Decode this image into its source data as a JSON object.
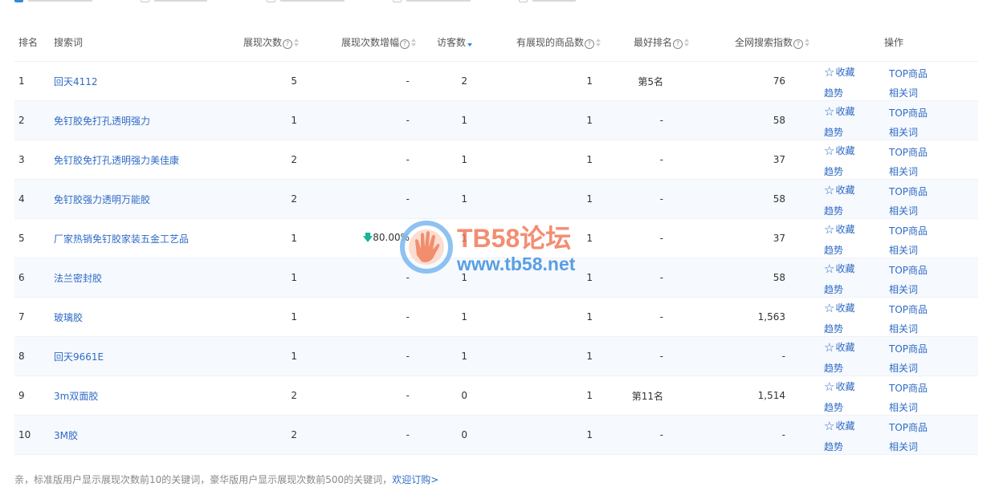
{
  "filters": [
    {
      "checked": true
    },
    {
      "checked": false
    },
    {
      "checked": false
    },
    {
      "checked": false
    },
    {
      "checked": false
    }
  ],
  "table": {
    "headers": {
      "rank": "排名",
      "keyword": "搜索词",
      "impressions": "展现次数",
      "growth": "展现次数增幅",
      "visitors": "访客数",
      "products": "有展现的商品数",
      "best_rank": "最好排名",
      "index": "全网搜索指数",
      "ops": "操作"
    },
    "ops_labels": {
      "favorite": "收藏",
      "top": "TOP商品",
      "trend": "趋势",
      "related": "相关词"
    },
    "rows": [
      {
        "rank": "1",
        "keyword": "回天4112",
        "impressions": "5",
        "growth": "-",
        "visitors": "2",
        "products": "1",
        "best_rank": "第5名",
        "index": "76"
      },
      {
        "rank": "2",
        "keyword": "免钉胶免打孔透明强力",
        "impressions": "1",
        "growth": "-",
        "visitors": "1",
        "products": "1",
        "best_rank": "-",
        "index": "58"
      },
      {
        "rank": "3",
        "keyword": "免钉胶免打孔透明强力美佳康",
        "impressions": "2",
        "growth": "-",
        "visitors": "1",
        "products": "1",
        "best_rank": "-",
        "index": "37"
      },
      {
        "rank": "4",
        "keyword": "免钉胶强力透明万能胶",
        "impressions": "2",
        "growth": "-",
        "visitors": "1",
        "products": "1",
        "best_rank": "-",
        "index": "58"
      },
      {
        "rank": "5",
        "keyword": "厂家热销免钉胶家装五金工艺品",
        "impressions": "1",
        "growth": "80.00%",
        "growth_down": true,
        "visitors": "1",
        "products": "1",
        "best_rank": "-",
        "index": "37"
      },
      {
        "rank": "6",
        "keyword": "法兰密封胶",
        "impressions": "1",
        "growth": "-",
        "visitors": "1",
        "products": "1",
        "best_rank": "-",
        "index": "58"
      },
      {
        "rank": "7",
        "keyword": "玻璃胶",
        "impressions": "1",
        "growth": "-",
        "visitors": "1",
        "products": "1",
        "best_rank": "-",
        "index": "1,563"
      },
      {
        "rank": "8",
        "keyword": "回天9661E",
        "impressions": "1",
        "growth": "-",
        "visitors": "1",
        "products": "1",
        "best_rank": "-",
        "index": "-"
      },
      {
        "rank": "9",
        "keyword": "3m双面胶",
        "impressions": "2",
        "growth": "-",
        "visitors": "0",
        "products": "1",
        "best_rank": "第11名",
        "index": "1,514"
      },
      {
        "rank": "10",
        "keyword": "3M胶",
        "impressions": "2",
        "growth": "-",
        "visitors": "0",
        "products": "1",
        "best_rank": "-",
        "index": "-"
      }
    ]
  },
  "footer": {
    "text": "亲，标准版用户显示展现次数前10的关键词，豪华版用户显示展现次数前500的关键词，",
    "link": "欢迎订购>"
  },
  "watermark": {
    "title": "TB58论坛",
    "url": "www.tb58.net"
  },
  "colors": {
    "link": "#2e6bc6",
    "accent": "#3089dc",
    "row_alt": "#f6f9fd",
    "down_arrow": "#1ab394"
  }
}
